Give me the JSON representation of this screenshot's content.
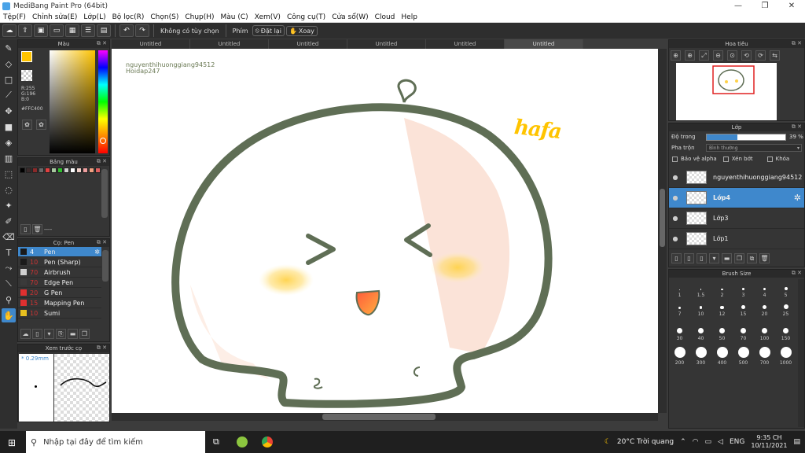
{
  "window": {
    "title": "MediBang Paint Pro (64bit)"
  },
  "menu": [
    "Tệp(F)",
    "Chỉnh sửa(E)",
    "Lớp(L)",
    "Bộ lọc(R)",
    "Chọn(S)",
    "Chụp(H)",
    "Màu (C)",
    "Xem(V)",
    "Công cụ(T)",
    "Cửa sổ(W)",
    "Cloud",
    "Help"
  ],
  "toolbar": {
    "no_option": "Không có tùy chọn",
    "key_label": "Phím",
    "reset_label": "Đặt lại",
    "rotate_label": "Xoay"
  },
  "tabs": [
    "Untitled",
    "Untitled",
    "Untitled",
    "Untitled",
    "Untitled",
    "Untitled"
  ],
  "color_panel": {
    "title": "Màu",
    "r": "R:255",
    "g": "G:196",
    "b": "B:0",
    "hex": "#FFC400",
    "current_color": "#FFC400"
  },
  "palette_panel": {
    "title": "Bảng màu",
    "colors": [
      "#000000",
      "#3a2a2a",
      "#8a2a2a",
      "#6a6a6a",
      "#e04040",
      "#a8c8a0",
      "#30c030",
      "#d0d0d0",
      "#ffffff",
      "#f0d0c8",
      "#f0a0a0",
      "#f0a080",
      "#e06060"
    ],
    "footer": "----"
  },
  "brush_panel": {
    "title": "Cọ: Pen",
    "items": [
      {
        "size": "4",
        "name": "Pen",
        "color": "#1a1a1a"
      },
      {
        "size": "10",
        "name": "Pen (Sharp)",
        "color": "#1a1a1a"
      },
      {
        "size": "70",
        "name": "Airbrush",
        "color": "#cfcfcf"
      },
      {
        "size": "70",
        "name": "Edge Pen",
        "color": "#3a3a3a"
      },
      {
        "size": "20",
        "name": "G Pen",
        "color": "#e03030"
      },
      {
        "size": "15",
        "name": "Mapping Pen",
        "color": "#e03030"
      },
      {
        "size": "10",
        "name": "Sumi",
        "color": "#e8c020"
      }
    ]
  },
  "preview_panel": {
    "title": "Xem trước cọ",
    "size": "0.29mm"
  },
  "canvas": {
    "watermark_line1": "nguyenthihuonggiang94512",
    "watermark_line2": "Hoidap247",
    "text": "hafa"
  },
  "navigator": {
    "title": "Hoa tiêu"
  },
  "layer_panel": {
    "title": "Lớp",
    "opacity_label": "Độ trong",
    "opacity_value": "39 %",
    "opacity_percent": 39,
    "blend_label": "Pha trộn",
    "blend_value": "Bình thường",
    "protect_alpha": "Bảo vệ alpha",
    "clipping": "Xén bớt",
    "lock": "Khóa",
    "layers": [
      {
        "name": "nguyenthihuonggiang94512"
      },
      {
        "name": "Lớp4"
      },
      {
        "name": "Lớp3"
      },
      {
        "name": "Lớp1"
      }
    ]
  },
  "brush_size_panel": {
    "title": "Brush Size",
    "sizes": [
      "1",
      "1.5",
      "2",
      "3",
      "4",
      "5",
      "7",
      "10",
      "12",
      "15",
      "20",
      "25",
      "30",
      "40",
      "50",
      "70",
      "100",
      "150",
      "200",
      "300",
      "400",
      "500",
      "700",
      "1000"
    ]
  },
  "taskbar": {
    "search": "Nhập tại đây để tìm kiếm",
    "weather": "20°C  Trời quang",
    "lang": "ENG",
    "time": "9:35 CH",
    "date": "10/11/2021"
  }
}
